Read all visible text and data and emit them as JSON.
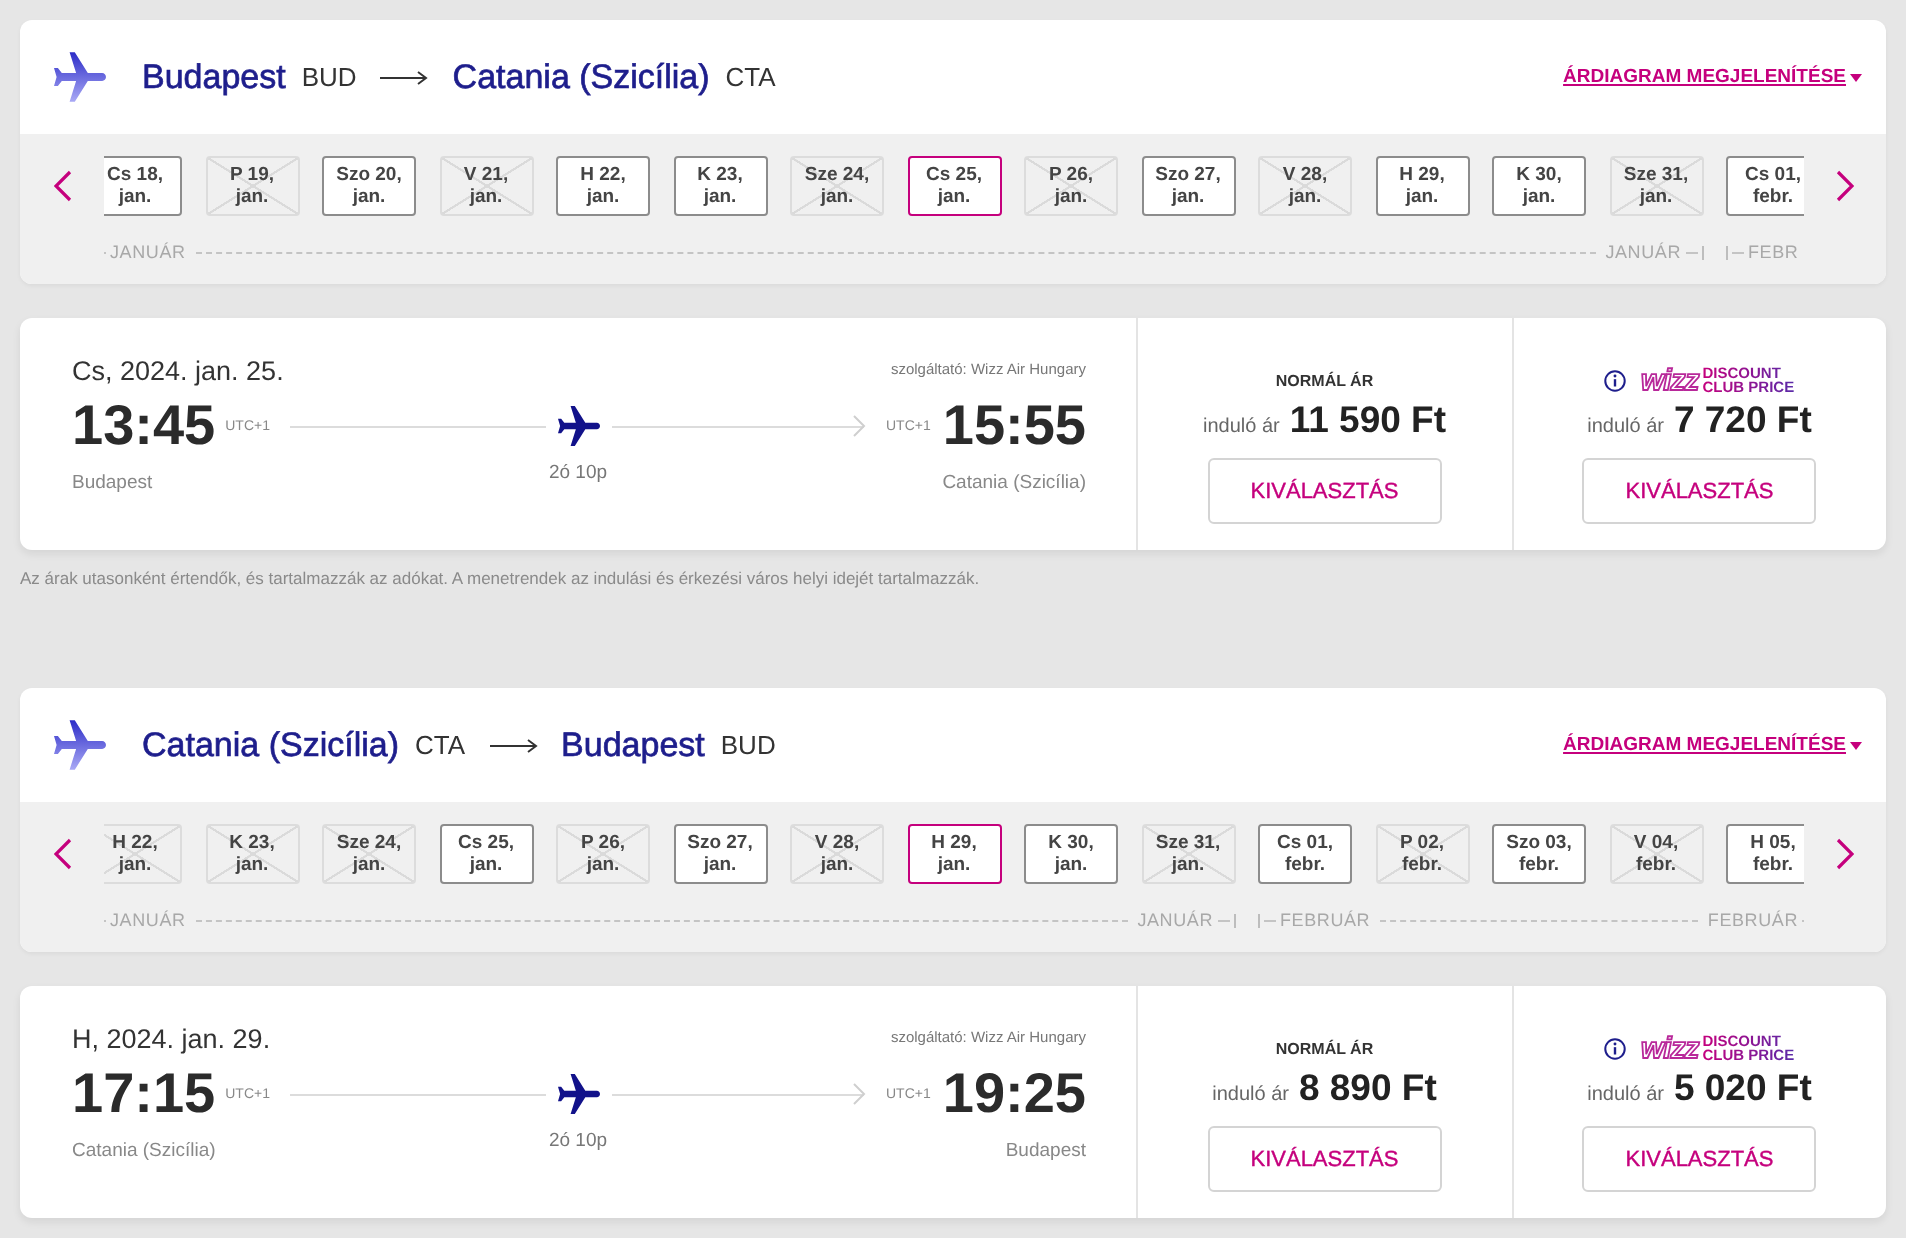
{
  "legs": [
    {
      "route": {
        "from_city": "Budapest",
        "from_code": "BUD",
        "to_city": "Catania (Szicília)",
        "to_code": "CTA",
        "chart_link": "ÁRDIAGRAM MEGJELENÍTÉSE"
      },
      "months": [
        {
          "label_start": "JANUÁR",
          "label_end": "JANUÁR",
          "days": [
            {
              "day": "Cs 18,",
              "month": "jan.",
              "available": true,
              "selected": false
            },
            {
              "day": "P 19,",
              "month": "jan.",
              "available": false,
              "selected": false
            },
            {
              "day": "Szo 20,",
              "month": "jan.",
              "available": true,
              "selected": false
            },
            {
              "day": "V 21,",
              "month": "jan.",
              "available": false,
              "selected": false
            },
            {
              "day": "H 22,",
              "month": "jan.",
              "available": true,
              "selected": false
            },
            {
              "day": "K 23,",
              "month": "jan.",
              "available": true,
              "selected": false
            },
            {
              "day": "Sze 24,",
              "month": "jan.",
              "available": false,
              "selected": false
            },
            {
              "day": "Cs 25,",
              "month": "jan.",
              "available": true,
              "selected": true
            },
            {
              "day": "P 26,",
              "month": "jan.",
              "available": false,
              "selected": false
            },
            {
              "day": "Szo 27,",
              "month": "jan.",
              "available": true,
              "selected": false
            },
            {
              "day": "V 28,",
              "month": "jan.",
              "available": false,
              "selected": false
            },
            {
              "day": "H 29,",
              "month": "jan.",
              "available": true,
              "selected": false
            },
            {
              "day": "K 30,",
              "month": "jan.",
              "available": true,
              "selected": false
            },
            {
              "day": "Sze 31,",
              "month": "jan.",
              "available": false,
              "selected": false
            }
          ]
        },
        {
          "label_start": "FEBR",
          "days": [
            {
              "day": "Cs 01,",
              "month": "febr.",
              "available": true,
              "selected": false
            }
          ]
        }
      ],
      "flight": {
        "date": "Cs, 2024. jan. 25.",
        "operator": "szolgáltató: Wizz Air Hungary",
        "depart_time": "13:45",
        "depart_tz": "UTC+1",
        "arrive_tz": "UTC+1",
        "arrive_time": "15:55",
        "depart_city": "Budapest",
        "duration": "2ó 10p",
        "arrive_city": "Catania (Szicília)"
      },
      "fares": [
        {
          "kind": "normal",
          "title": "NORMÁL ÁR",
          "from_label": "induló ár",
          "price": "11 590 Ft",
          "button": "KIVÁLASZTÁS"
        },
        {
          "kind": "club",
          "logo": "wizz",
          "badge_lines": [
            "DISCOUNT",
            "CLUB PRICE"
          ],
          "from_label": "induló ár",
          "price": "7 720 Ft",
          "button": "KIVÁLASZTÁS"
        }
      ],
      "note": "Az árak utasonként értendők, és tartalmazzák az adókat. A menetrendek az indulási és érkezési város helyi idejét tartalmazzák."
    },
    {
      "route": {
        "from_city": "Catania (Szicília)",
        "from_code": "CTA",
        "to_city": "Budapest",
        "to_code": "BUD",
        "chart_link": "ÁRDIAGRAM MEGJELENÍTÉSE"
      },
      "months": [
        {
          "label_start": "JANUÁR",
          "label_end": "JANUÁR",
          "days": [
            {
              "day": "H 22,",
              "month": "jan.",
              "available": false,
              "selected": false
            },
            {
              "day": "K 23,",
              "month": "jan.",
              "available": false,
              "selected": false
            },
            {
              "day": "Sze 24,",
              "month": "jan.",
              "available": false,
              "selected": false
            },
            {
              "day": "Cs 25,",
              "month": "jan.",
              "available": true,
              "selected": false
            },
            {
              "day": "P 26,",
              "month": "jan.",
              "available": false,
              "selected": false
            },
            {
              "day": "Szo 27,",
              "month": "jan.",
              "available": true,
              "selected": false
            },
            {
              "day": "V 28,",
              "month": "jan.",
              "available": false,
              "selected": false
            },
            {
              "day": "H 29,",
              "month": "jan.",
              "available": true,
              "selected": true
            },
            {
              "day": "K 30,",
              "month": "jan.",
              "available": true,
              "selected": false
            },
            {
              "day": "Sze 31,",
              "month": "jan.",
              "available": false,
              "selected": false
            }
          ]
        },
        {
          "label_start": "FEBRUÁR",
          "label_end": "FEBRUÁR",
          "days": [
            {
              "day": "Cs 01,",
              "month": "febr.",
              "available": true,
              "selected": false
            },
            {
              "day": "P 02,",
              "month": "febr.",
              "available": false,
              "selected": false
            },
            {
              "day": "Szo 03,",
              "month": "febr.",
              "available": true,
              "selected": false
            },
            {
              "day": "V 04,",
              "month": "febr.",
              "available": false,
              "selected": false
            },
            {
              "day": "H 05,",
              "month": "febr.",
              "available": true,
              "selected": false
            }
          ]
        }
      ],
      "flight": {
        "date": "H, 2024. jan. 29.",
        "operator": "szolgáltató: Wizz Air Hungary",
        "depart_time": "17:15",
        "depart_tz": "UTC+1",
        "arrive_tz": "UTC+1",
        "arrive_time": "19:25",
        "depart_city": "Catania (Szicília)",
        "duration": "2ó 10p",
        "arrive_city": "Budapest"
      },
      "fares": [
        {
          "kind": "normal",
          "title": "NORMÁL ÁR",
          "from_label": "induló ár",
          "price": "8 890 Ft",
          "button": "KIVÁLASZTÁS"
        },
        {
          "kind": "club",
          "logo": "wizz",
          "badge_lines": [
            "DISCOUNT",
            "CLUB PRICE"
          ],
          "from_label": "induló ár",
          "price": "5 020 Ft",
          "button": "KIVÁLASZTÁS"
        }
      ]
    }
  ]
}
